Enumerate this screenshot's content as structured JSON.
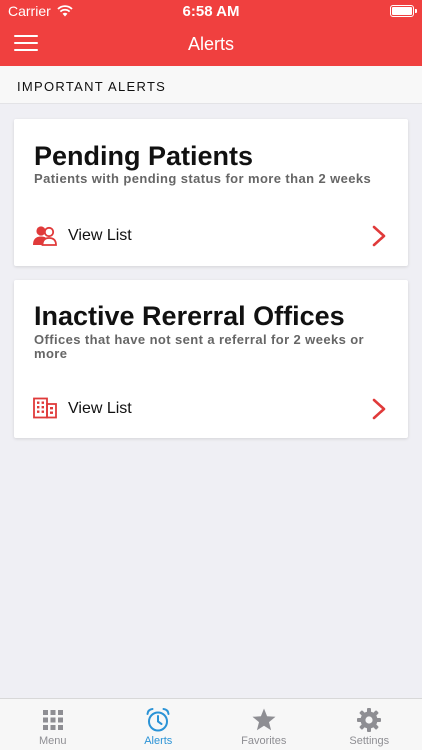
{
  "status_bar": {
    "carrier": "Carrier",
    "time": "6:58 AM"
  },
  "nav": {
    "title": "Alerts"
  },
  "section": {
    "header": "IMPORTANT ALERTS"
  },
  "cards": [
    {
      "title": "Pending Patients",
      "subtitle": "Patients with pending status for more than 2 weeks",
      "action_label": "View List",
      "icon": "users-icon"
    },
    {
      "title": "Inactive Rererral Offices",
      "subtitle": "Offices that have not sent a referral for 2 weeks or more",
      "action_label": "View List",
      "icon": "building-icon"
    }
  ],
  "tabs": [
    {
      "label": "Menu",
      "icon": "grid-icon",
      "active": false
    },
    {
      "label": "Alerts",
      "icon": "alarm-clock-icon",
      "active": true
    },
    {
      "label": "Favorites",
      "icon": "star-icon",
      "active": false
    },
    {
      "label": "Settings",
      "icon": "gear-icon",
      "active": false
    }
  ],
  "colors": {
    "brand_red": "#f0403f",
    "background": "#efeff4",
    "tab_active": "#2b93d6",
    "tab_inactive": "#8e8e93"
  }
}
